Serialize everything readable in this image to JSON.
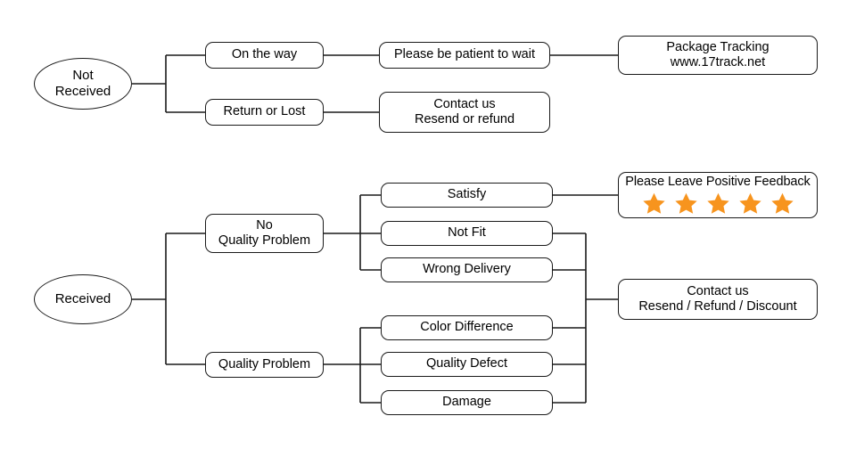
{
  "diagram": {
    "type": "flowchart",
    "title": "",
    "branches": {
      "not_received": {
        "root_label_line1": "Not",
        "root_label_line2": "Received",
        "steps": {
          "on_the_way": "On the way",
          "on_the_way_action": "Please be patient to wait",
          "tracking_line1": "Package Tracking",
          "tracking_line2": "www.17track.net",
          "return_or_lost": "Return or Lost",
          "return_action_line1": "Contact us",
          "return_action_line2": "Resend or refund"
        }
      },
      "received": {
        "root_label": "Received",
        "no_quality_problem_line1": "No",
        "no_quality_problem_line2": "Quality Problem",
        "quality_problem": "Quality Problem",
        "no_quality_reasons": {
          "satisfy": "Satisfy",
          "not_fit": "Not Fit",
          "wrong_delivery": "Wrong Delivery"
        },
        "quality_reasons": {
          "color_difference": "Color Difference",
          "quality_defect": "Quality Defect",
          "damage": "Damage"
        },
        "outcomes": {
          "feedback_title": "Please Leave Positive Feedback",
          "feedback_star_count": 5,
          "contact_line1": "Contact us",
          "contact_line2": "Resend / Refund / Discount"
        }
      }
    },
    "colors": {
      "stroke": "#1a1a1a",
      "background": "#ffffff",
      "star_fill": "#f7941e",
      "text": "#000000"
    }
  }
}
